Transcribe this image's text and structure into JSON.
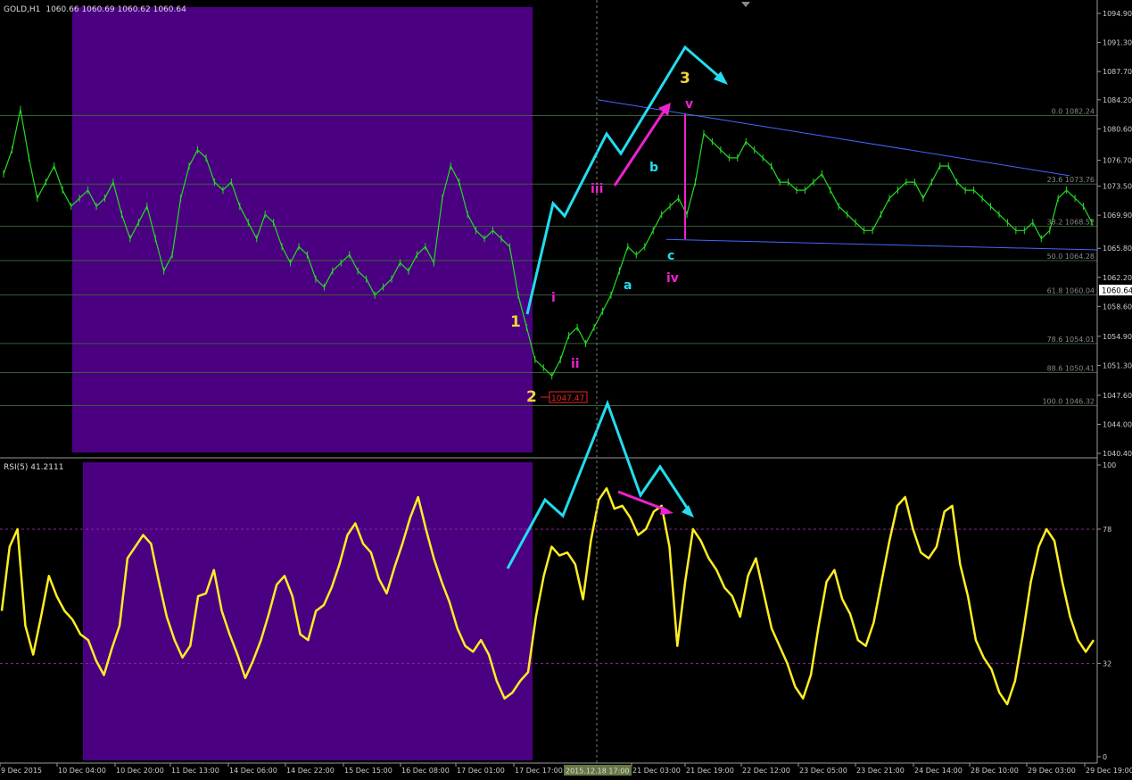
{
  "header": {
    "symbol": "GOLD,H1",
    "ohlc": "1060.66 1060.69 1060.62 1060.64"
  },
  "rsi_header": {
    "label": "RSI(5) 41.2111"
  },
  "colors": {
    "background": "#000000",
    "price_line": "#22dd22",
    "rsi_line": "#ffee22",
    "highlight": "#4b0082",
    "trend": "#4466ff",
    "cyan": "#22ddf0",
    "magenta": "#ee22cc",
    "yellow_label": "#f0d23c",
    "fib": "#3a5e3a",
    "axis_text": "#cccccc"
  },
  "waves": {
    "w1": "1",
    "w2": "2",
    "w3": "3",
    "i": "i",
    "ii": "ii",
    "iii": "iii",
    "iv": "iv",
    "v": "v",
    "a": "a",
    "b": "b",
    "c": "c"
  },
  "low_marker": "1047.47",
  "current_price": "1060.64",
  "cursor_time": "2015.12.18 17:00",
  "chart_data": [
    {
      "type": "line",
      "instrument": "GOLD,H1",
      "ylim": [
        1040.4,
        1094.9
      ],
      "y_ticks": [
        "1094.90",
        "1091.30",
        "1087.70",
        "1084.20",
        "1080.60",
        "1076.70",
        "1073.50",
        "1069.90",
        "1065.80",
        "1062.20",
        "1058.60",
        "1054.90",
        "1051.30",
        "1047.60",
        "1044.00",
        "1040.40"
      ],
      "fib_levels": [
        {
          "label": "0.0 1082.24",
          "value": 1082.24
        },
        {
          "label": "23.6 1073.76",
          "value": 1073.76
        },
        {
          "label": "38.2 1068.52",
          "value": 1068.52
        },
        {
          "label": "50.0 1064.28",
          "value": 1064.28
        },
        {
          "label": "61.8 1060.04",
          "value": 1060.04
        },
        {
          "label": "78.6 1054.01",
          "value": 1054.01
        },
        {
          "label": "88.6 1050.41",
          "value": 1050.41
        },
        {
          "label": "100.0 1046.32",
          "value": 1046.32
        }
      ],
      "series": [
        {
          "values": [
            1075,
            1078,
            1083,
            1077,
            1072,
            1074,
            1076,
            1073,
            1071,
            1072,
            1073,
            1071,
            1072,
            1074,
            1070,
            1067,
            1069,
            1071,
            1067,
            1063,
            1065,
            1072,
            1076,
            1078,
            1077,
            1074,
            1073,
            1074,
            1071,
            1069,
            1067,
            1070,
            1069,
            1066,
            1064,
            1066,
            1065,
            1062,
            1061,
            1063,
            1064,
            1065,
            1063,
            1062,
            1060,
            1061,
            1062,
            1064,
            1063,
            1065,
            1066,
            1064,
            1072,
            1076,
            1074,
            1070,
            1068,
            1067,
            1068,
            1067,
            1066,
            1060,
            1056,
            1052,
            1051,
            1050,
            1052,
            1055,
            1056,
            1054,
            1056,
            1058,
            1060,
            1063,
            1066,
            1065,
            1066,
            1068,
            1070,
            1071,
            1072,
            1070,
            1074,
            1080,
            1079,
            1078,
            1077,
            1077,
            1079,
            1078,
            1077,
            1076,
            1074,
            1074,
            1073,
            1073,
            1074,
            1075,
            1073,
            1071,
            1070,
            1069,
            1068,
            1068,
            1070,
            1072,
            1073,
            1074,
            1074,
            1072,
            1074,
            1076,
            1076,
            1074,
            1073,
            1073,
            1072,
            1071,
            1070,
            1069,
            1068,
            1068,
            1069,
            1067,
            1068,
            1072,
            1073,
            1072,
            1071,
            1069
          ]
        }
      ]
    },
    {
      "type": "line",
      "indicator": "RSI(5)",
      "ylim": [
        0,
        100
      ],
      "y_ticks": [
        "100",
        "78",
        "32",
        "0"
      ],
      "levels": [
        78,
        32
      ],
      "series": [
        {
          "values": [
            50,
            72,
            78,
            45,
            35,
            48,
            62,
            55,
            50,
            47,
            42,
            40,
            33,
            28,
            37,
            45,
            68,
            72,
            76,
            73,
            60,
            48,
            40,
            34,
            38,
            55,
            56,
            64,
            50,
            42,
            35,
            27,
            33,
            40,
            49,
            59,
            62,
            55,
            42,
            40,
            50,
            52,
            58,
            66,
            76,
            80,
            73,
            70,
            61,
            56,
            65,
            73,
            82,
            89,
            78,
            68,
            60,
            53,
            44,
            38,
            36,
            40,
            35,
            26,
            20,
            22,
            26,
            29,
            48,
            62,
            72,
            69,
            70,
            66,
            54,
            74,
            88,
            92,
            85,
            86,
            82,
            76,
            78,
            84,
            86,
            72,
            38,
            60,
            78,
            74,
            68,
            64,
            58,
            55,
            48,
            62,
            68,
            56,
            44,
            38,
            32,
            24,
            20,
            28,
            45,
            60,
            64,
            54,
            49,
            40,
            38,
            46,
            60,
            74,
            86,
            89,
            78,
            70,
            68,
            72,
            84,
            86,
            66,
            55,
            40,
            34,
            30,
            22,
            18,
            26,
            42,
            60,
            72,
            78,
            74,
            60,
            48,
            40,
            36,
            40
          ]
        }
      ]
    }
  ],
  "x_axis": {
    "ticks": [
      "9 Dec 2015",
      "10 Dec 04:00",
      "10 Dec 20:00",
      "11 Dec 13:00",
      "14 Dec 06:00",
      "14 Dec 22:00",
      "15 Dec 15:00",
      "16 Dec 08:00",
      "17 Dec 01:00",
      "17 Dec 17:00",
      "2015.12.18 17:00",
      "21 Dec 03:00",
      "21 Dec 19:00",
      "22 Dec 12:00",
      "23 Dec 05:00",
      "23 Dec 21:00",
      "24 Dec 14:00",
      "28 Dec 10:00",
      "29 Dec 03:00",
      "29 Dec 19:00"
    ]
  }
}
